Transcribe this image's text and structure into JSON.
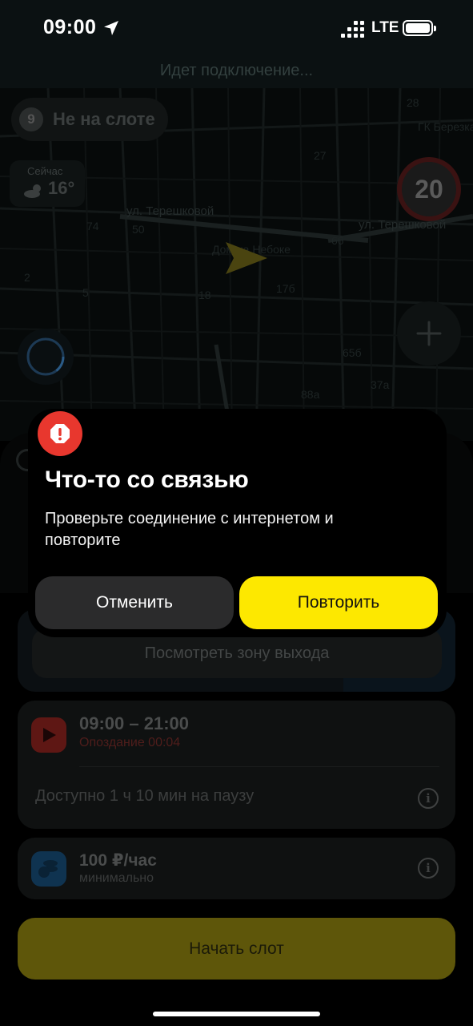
{
  "status_bar": {
    "time": "09:00",
    "network": "LTE"
  },
  "header": {
    "connecting_text": "Идет подключение..."
  },
  "map": {
    "slot_number": "9",
    "slot_status": "Не на слоте",
    "weather_label": "Сейчас",
    "temperature": "16°",
    "speed_limit": "20",
    "labels": {
      "street_1": "ул. Терешковой",
      "street_2": "ул. Терешковой",
      "place": "Дом на Небоке",
      "district": "ГК Березка",
      "n1": "74",
      "n2": "50",
      "n3": "18",
      "n4": "17б",
      "n5": "66",
      "n6": "27",
      "n7": "28",
      "n8": "65б",
      "n9": "37а",
      "n10": "88а",
      "n11": "5",
      "n12": "2"
    }
  },
  "dialog": {
    "title": "Что-то со связью",
    "message": "Проверьте соединение с интернетом и повторите",
    "cancel_label": "Отменить",
    "retry_label": "Повторить"
  },
  "exit_zone": {
    "button_label": "Посмотреть зону выхода"
  },
  "shift": {
    "time_range": "09:00 – 21:00",
    "late_text": "Опоздание 00:04",
    "pause_text": "Доступно 1 ч 10 мин на паузу"
  },
  "rate": {
    "value": "100 ₽/час",
    "subtitle": "минимально"
  },
  "start_button": {
    "label": "Начать слот"
  },
  "colors": {
    "accent_yellow": "#fde800",
    "alert_red": "#e8372e",
    "background": "#000000"
  },
  "icons": {
    "location": "location-arrow-icon",
    "alert": "alert-icon",
    "play": "play-icon",
    "info": "info-icon",
    "coins": "coins-icon",
    "weather": "cloud-sun-icon",
    "plus": "plus-icon",
    "compass": "compass-icon",
    "car": "navigation-arrow-icon"
  }
}
